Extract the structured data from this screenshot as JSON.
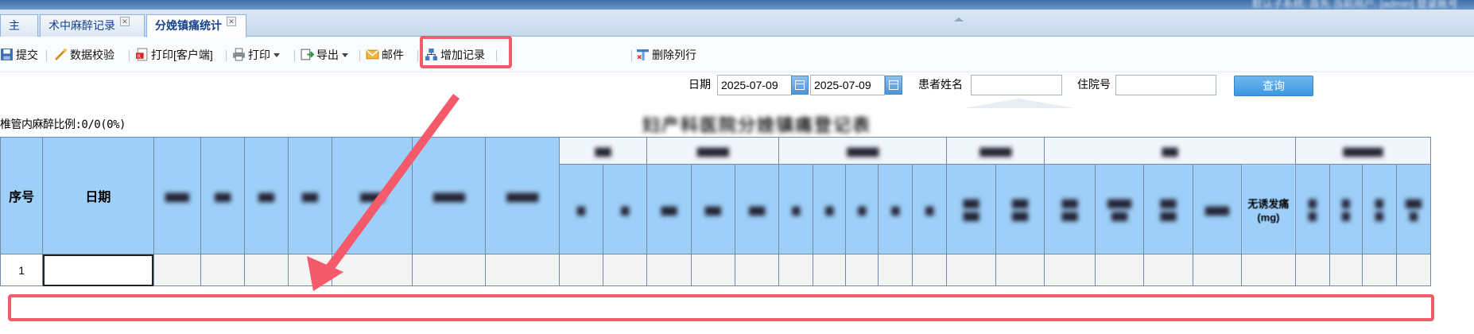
{
  "banner": {
    "user_text": "默认子系统: 首先 当前用户: [admin] 登录账号"
  },
  "tabs": [
    {
      "label": "主页"
    },
    {
      "label": "术中麻醉记录"
    },
    {
      "label": "分娩镇痛统计"
    }
  ],
  "toolbar": {
    "submit": "提交",
    "validate": "数据校验",
    "print_client": "打印[客户端]",
    "print": "打印",
    "export": "导出",
    "mail": "邮件",
    "add_record": "增加记录",
    "delete_column": "删除列行"
  },
  "search": {
    "date_label": "日期",
    "date_from": "2025-07-09",
    "date_to": "2025-07-09",
    "patient_label": "患者姓名",
    "patient_value": "",
    "inpatient_label": "住院号",
    "inpatient_value": "",
    "query_button": "查询"
  },
  "ratio_text": "椎管内麻醉比例:0/0(0%)",
  "report_title": "妇产科医院分娩镇痛登记表",
  "table": {
    "col_index": "序号",
    "col_date": "日期",
    "partial_header": "无诱发痛(mg)",
    "rows": [
      {
        "index": "1",
        "date": ""
      }
    ]
  },
  "annotation_color": "#f55a6b"
}
